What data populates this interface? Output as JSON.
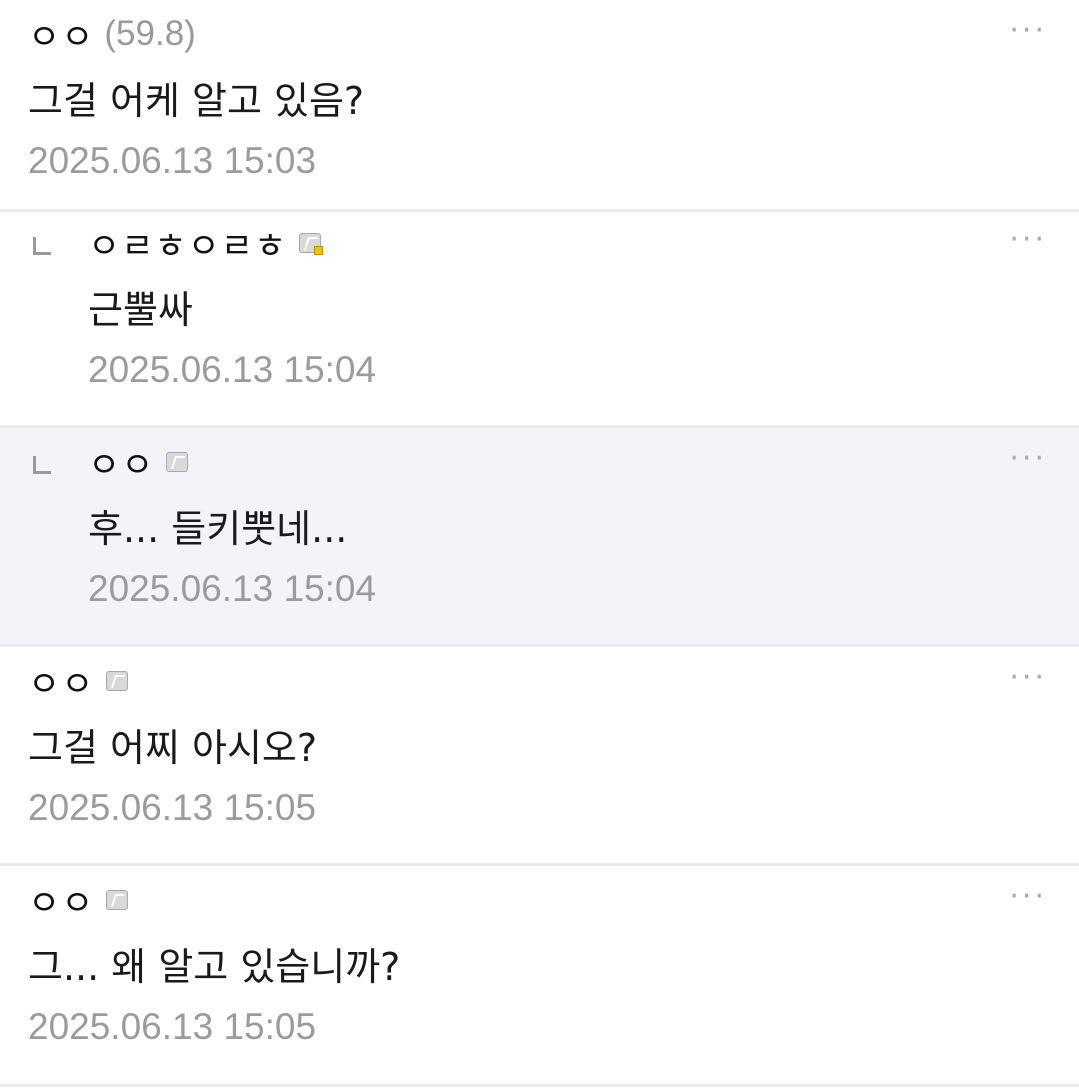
{
  "comments": [
    {
      "nick": "ㅇㅇ",
      "ip": "(59.8)",
      "text": "그걸 어케 알고 있음?",
      "time": "2025.06.13 15:03",
      "more": "···"
    },
    {
      "nick": "ㅇㄹㅎㅇㄹㅎ",
      "text": "근뿔싸",
      "time": "2025.06.13 15:04",
      "more": "···",
      "badge": "fixed-nick-badge-icon"
    },
    {
      "nick": "ㅇㅇ",
      "text": "후... 들키뿟네...",
      "time": "2025.06.13 15:04",
      "more": "···",
      "badge": "semi-fixed-nick-badge-icon"
    },
    {
      "nick": "ㅇㅇ",
      "text": "그걸 어찌 아시오?",
      "time": "2025.06.13 15:05",
      "more": "···",
      "badge": "semi-fixed-nick-badge-icon"
    },
    {
      "nick": "ㅇㅇ",
      "text": "그... 왜 알고 있습니까?",
      "time": "2025.06.13 15:05",
      "more": "···",
      "badge": "semi-fixed-nick-badge-icon"
    }
  ],
  "colors": {
    "highlight_bg": "#f3f4fa",
    "timestamp": "#9b9b9b",
    "fixed_badge_dot": "#f2c400"
  }
}
